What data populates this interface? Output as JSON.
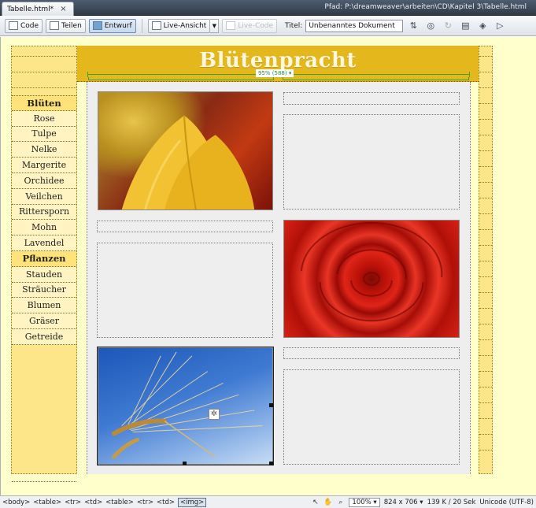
{
  "document_tab": {
    "label": "Tabelle.html*",
    "close": "×"
  },
  "path_label": "Pfad:  P:\\dreamweaver\\arbeiten\\CD\\Kapitel 3\\Tabelle.html",
  "toolbar": {
    "code": "Code",
    "split": "Teilen",
    "design": "Entwurf",
    "live_view": "Live-Ansicht",
    "live_code": "Live-Code",
    "title_label": "Titel:",
    "title_value": "Unbenanntes Dokument"
  },
  "page": {
    "site_title": "Blütenpracht",
    "ruler_label": "95% (588) ▾"
  },
  "nav": [
    {
      "label": "Blüten",
      "type": "category"
    },
    {
      "label": "Rose",
      "type": "item"
    },
    {
      "label": "Tulpe",
      "type": "item"
    },
    {
      "label": "Nelke",
      "type": "item"
    },
    {
      "label": "Margerite",
      "type": "item"
    },
    {
      "label": "Orchidee",
      "type": "item"
    },
    {
      "label": "Veilchen",
      "type": "item"
    },
    {
      "label": "Rittersporn",
      "type": "item"
    },
    {
      "label": "Mohn",
      "type": "item"
    },
    {
      "label": "Lavendel",
      "type": "item"
    },
    {
      "label": "Pflanzen",
      "type": "category"
    },
    {
      "label": "Stauden",
      "type": "item"
    },
    {
      "label": "Sträucher",
      "type": "item"
    },
    {
      "label": "Blumen",
      "type": "item"
    },
    {
      "label": "Gräser",
      "type": "item"
    },
    {
      "label": "Getreide",
      "type": "item"
    }
  ],
  "statusbar": {
    "tags": [
      "<body>",
      "<table>",
      "<tr>",
      "<td>",
      "<table>",
      "<tr>",
      "<td>"
    ],
    "current_tag": "<img>",
    "zoom": "100%",
    "window_size": "824 x 706",
    "download": "139 K / 20 Sek",
    "encoding": "Unicode (UTF-8)"
  },
  "colors": {
    "canvas_bg": "#ffffcc",
    "header_band": "#e4b71d",
    "nav_category_bg": "#ffe27a",
    "ruler_green": "#37a53a"
  }
}
